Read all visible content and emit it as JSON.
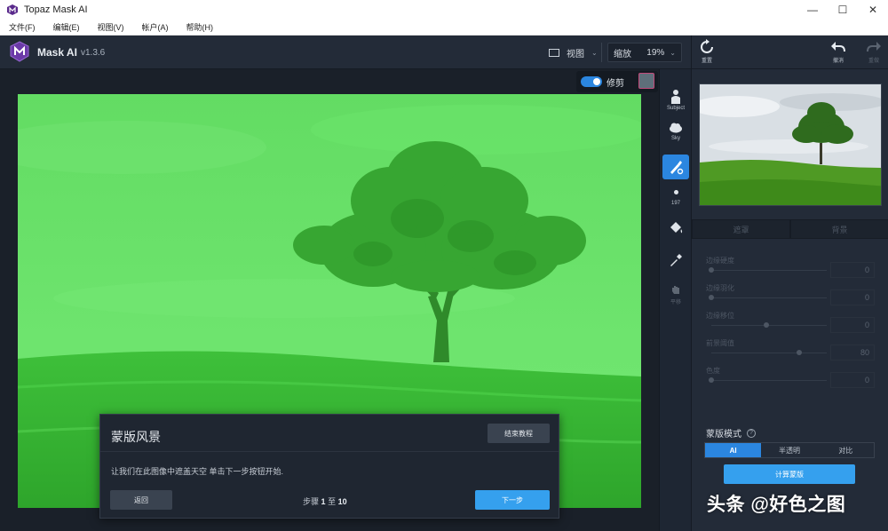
{
  "window": {
    "title": "Topaz Mask AI",
    "minimize": "—",
    "maximize": "☐",
    "close": "✕"
  },
  "menu": [
    "文件(F)",
    "编辑(E)",
    "视图(V)",
    "帐户(A)",
    "帮助(H)"
  ],
  "header": {
    "app_name": "Mask AI",
    "version": "v1.3.6",
    "view_label": "视图",
    "zoom_label": "缩放",
    "zoom_value": "19%"
  },
  "canvas": {
    "trim_label": "修剪",
    "trim_on": true,
    "mask_overlay_color": "#5ee65e"
  },
  "tools": {
    "subject": "Subject",
    "sky": "Sky",
    "brush_size": "197",
    "pan": "平移"
  },
  "right_panel": {
    "reset": "重置",
    "undo": "撤消",
    "redo": "重做",
    "tabs": [
      "遮罩",
      "背景"
    ],
    "sliders": [
      {
        "label": "边缘硬度",
        "value": "0",
        "level": 0
      },
      {
        "label": "边缘羽化",
        "value": "0",
        "level": 0
      },
      {
        "label": "边缘移位",
        "value": "0",
        "level": 0.5
      },
      {
        "label": "前景阈值",
        "value": "80",
        "level": 0.8
      },
      {
        "label": "色度",
        "value": "0",
        "level": 0
      }
    ],
    "mask_mode_label": "蒙版模式",
    "mask_modes": [
      "AI",
      "半透明",
      "对比"
    ],
    "mask_mode_selected": "AI",
    "compute_button": "计算蒙版"
  },
  "tutorial": {
    "title": "蒙版风景",
    "end_button": "结束教程",
    "body": "让我们在此图像中遮盖天空 单击下一步按钮开始.",
    "back_button": "返回",
    "step_prefix": "步骤",
    "step_current": "1",
    "step_sep": "至",
    "step_total": "10",
    "next_button": "下一步"
  },
  "watermark": "头条 @好色之图",
  "colors": {
    "accent": "#2b86e0",
    "button_blue": "#35a0ee",
    "panel": "#232b38"
  }
}
